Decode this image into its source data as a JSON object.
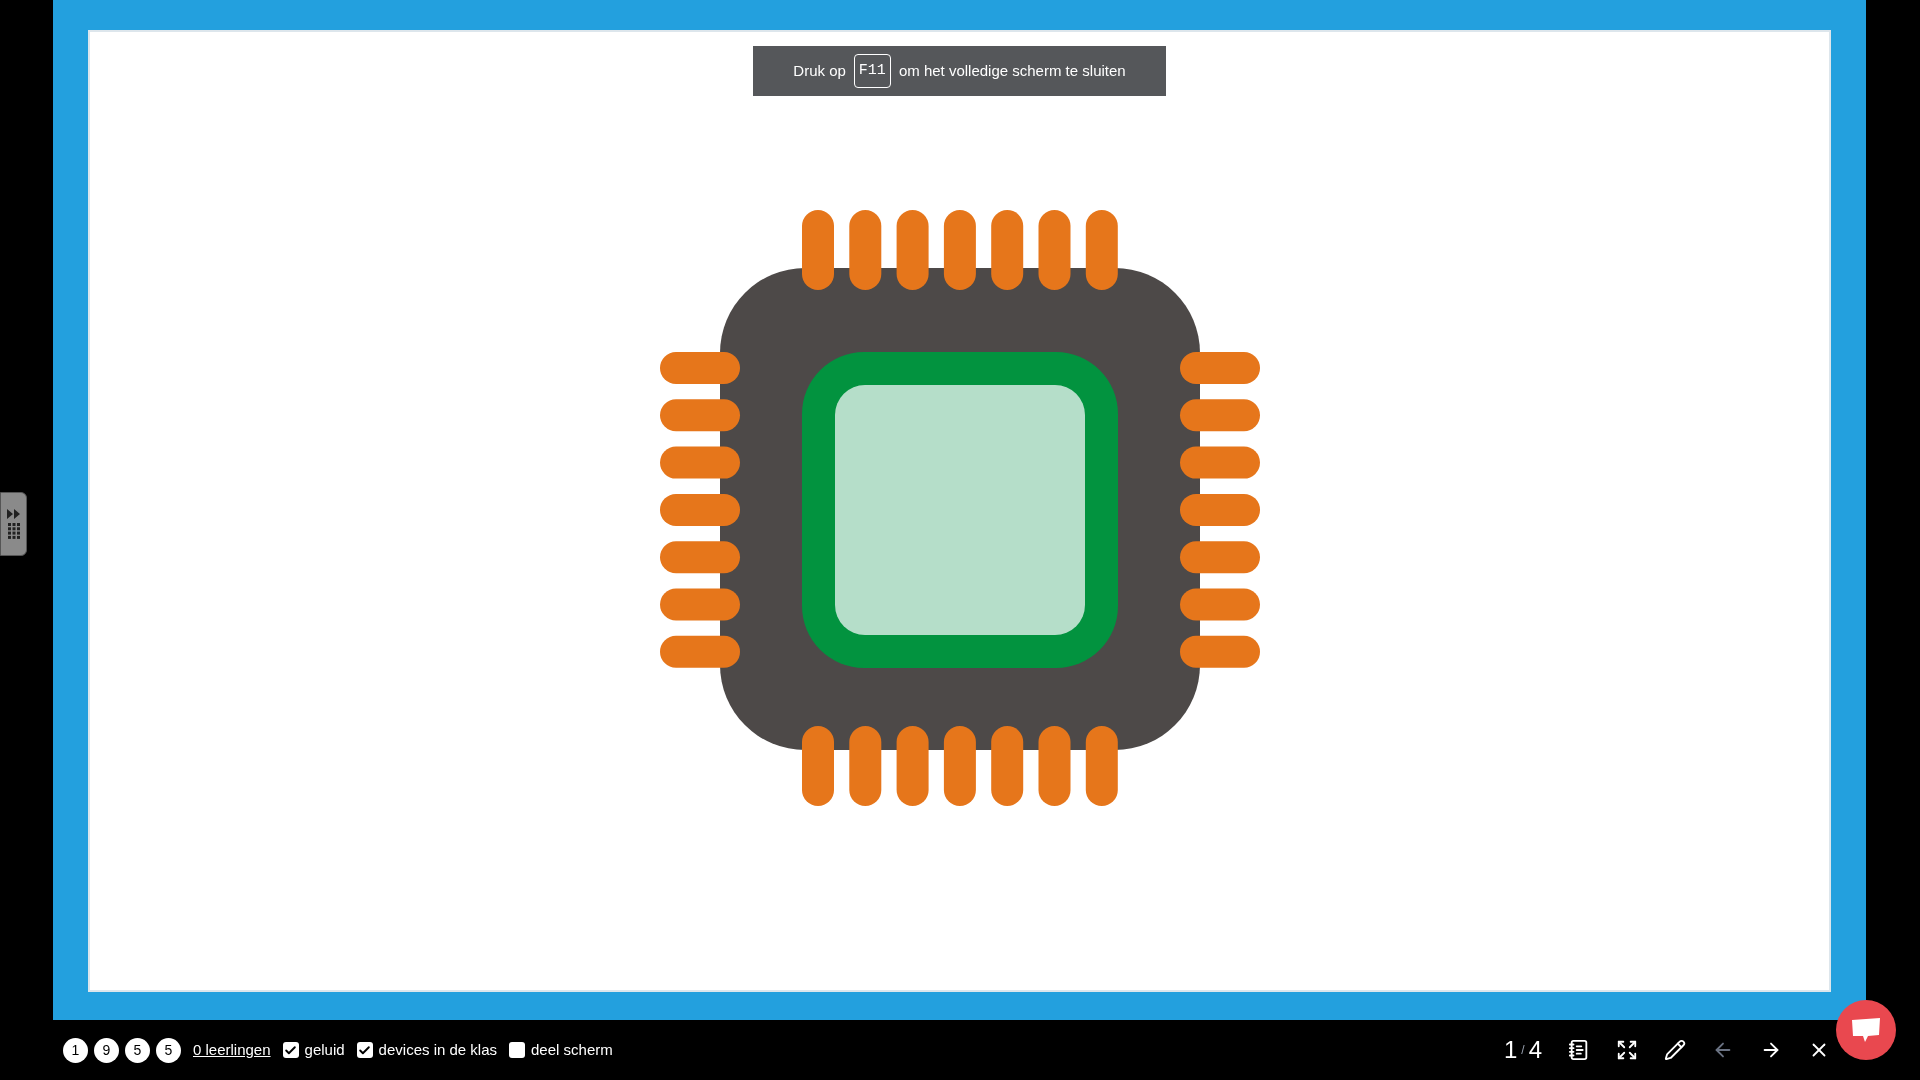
{
  "banner": {
    "before": "Druk op",
    "key": "F11",
    "after": "om het volledige scherm te sluiten"
  },
  "bottom_bar": {
    "code_digits": [
      "1",
      "9",
      "5",
      "5"
    ],
    "students_link": "0 leerlingen",
    "options": [
      {
        "label": "geluid",
        "checked": true
      },
      {
        "label": "devices in de klas",
        "checked": true
      },
      {
        "label": "deel scherm",
        "checked": false
      }
    ],
    "pager": {
      "current": "1",
      "separator": "/",
      "total": "4"
    },
    "tools": [
      {
        "kind": "notes",
        "disabled": false
      },
      {
        "kind": "fullscreen",
        "disabled": false
      },
      {
        "kind": "pen",
        "disabled": false
      },
      {
        "kind": "prev",
        "disabled": true
      },
      {
        "kind": "next",
        "disabled": false
      },
      {
        "kind": "close",
        "disabled": false
      }
    ]
  }
}
